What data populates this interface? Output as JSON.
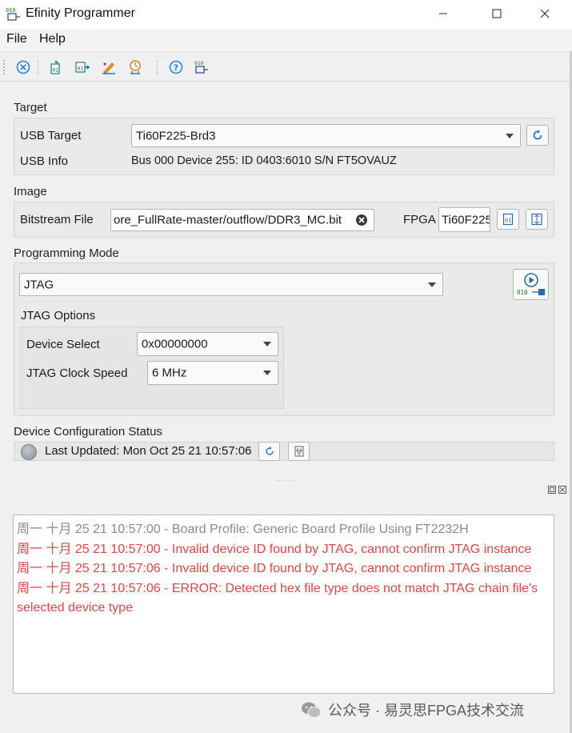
{
  "window": {
    "title": "Efinity Programmer",
    "icon": "binary-010-icon",
    "controls": [
      "minimize-icon",
      "maximize-icon",
      "close-icon"
    ]
  },
  "menu": {
    "items": [
      "File",
      "Help"
    ]
  },
  "toolbar": {
    "icons": [
      "stop-icon",
      "open-file-icon",
      "program-icon",
      "edit-icon",
      "reset-icon",
      "help-icon",
      "binary-icon"
    ]
  },
  "target": {
    "section_label": "Target",
    "usb_target_label": "USB Target",
    "usb_target_value": "Ti60F225-Brd3",
    "usb_info_label": "USB Info",
    "usb_info_value": "Bus 000 Device 255: ID 0403:6010 S/N FT5OVAUZ"
  },
  "image": {
    "section_label": "Image",
    "bitstream_label": "Bitstream File",
    "bitstream_value": "ore_FullRate-master/outflow/DDR3_MC.bit",
    "fpga_label": "FPGA",
    "fpga_value": "Ti60F225"
  },
  "programming": {
    "section_label": "Programming Mode",
    "mode_value": "JTAG",
    "jtag_options_label": "JTAG Options",
    "device_select_label": "Device Select",
    "device_select_value": "0x00000000",
    "clock_speed_label": "JTAG Clock Speed",
    "clock_speed_value": "6 MHz",
    "start_icon_text": "010"
  },
  "status": {
    "section_label": "Device Configuration Status",
    "last_updated": "Last Updated: Mon Oct 25 21 10:57:06"
  },
  "log": {
    "lines": [
      {
        "text": "周一 十月 25 21 10:57:00 - Board Profile: Generic Board Profile Using FT2232H",
        "color": "#8a8a8a"
      },
      {
        "text": "周一 十月 25 21 10:57:00 - Invalid device ID found by JTAG, cannot confirm JTAG instance",
        "color": "#e84545"
      },
      {
        "text": "周一 十月 25 21 10:57:06 - Invalid device ID found by JTAG, cannot confirm JTAG instance",
        "color": "#e84545"
      },
      {
        "text": "周一 十月 25 21 10:57:06 - ERROR: Detected hex file type does not match JTAG chain file's selected device type",
        "color": "#e84545"
      }
    ]
  },
  "watermark": {
    "text": "公众号 · 易灵思FPGA技术交流"
  }
}
